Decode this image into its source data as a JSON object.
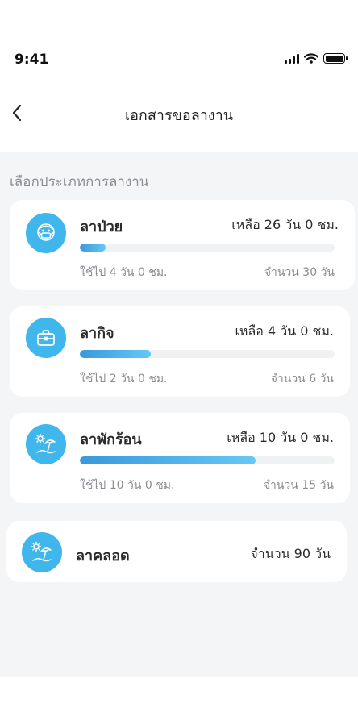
{
  "status_bar": {
    "time": "9:41"
  },
  "nav": {
    "title": "เอกสารขอลางาน"
  },
  "section_title": "เลือกประเภทการลางาน",
  "leave_types": [
    {
      "name": "ลาป่วย",
      "remaining": "เหลือ 26 วัน 0 ชม.",
      "used": "ใช้ไป 4 วัน 0 ชม.",
      "total": "จำนวน 30 วัน",
      "used_fraction": 0.1,
      "icon": "sick-mask-icon"
    },
    {
      "name": "ลากิจ",
      "remaining": "เหลือ 4 วัน 0 ชม.",
      "used": "ใช้ไป 2 วัน 0 ชม.",
      "total": "จำนวน 6 วัน",
      "used_fraction": 0.28,
      "icon": "briefcase-icon"
    },
    {
      "name": "ลาพักร้อน",
      "remaining": "เหลือ 10 วัน 0 ชม.",
      "used": "ใช้ไป 10 วัน 0 ชม.",
      "total": "จำนวน 15 วัน",
      "used_fraction": 0.69,
      "icon": "beach-umbrella-icon"
    },
    {
      "name": "ลาคลอด",
      "total": "จำนวน 90 วัน",
      "icon": "beach-umbrella-icon"
    }
  ],
  "colors": {
    "accent": "#3fb6ec",
    "progress_start": "#3a98dc",
    "progress_end": "#66c8f5",
    "background": "#f4f5f7",
    "muted_text": "#8a8d93"
  }
}
